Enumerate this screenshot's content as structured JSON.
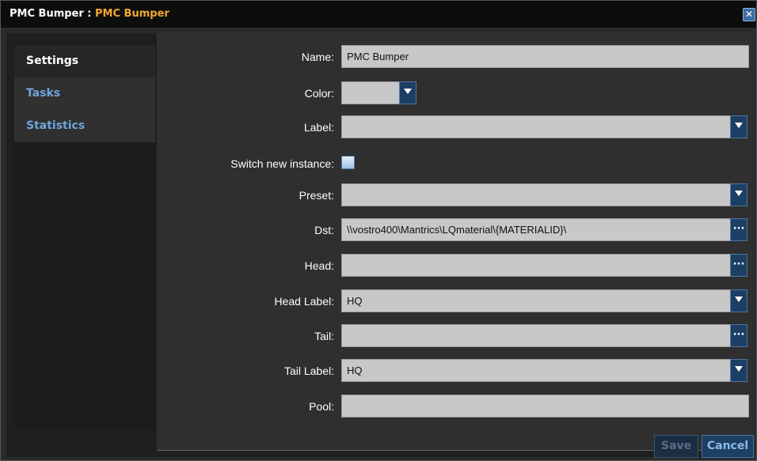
{
  "window": {
    "title_prefix": "PMC Bumper : ",
    "title_name": "PMC Bumper",
    "close_label": "✕"
  },
  "sidebar": {
    "items": [
      {
        "label": "Settings",
        "active": true
      },
      {
        "label": "Tasks",
        "active": false
      },
      {
        "label": "Statistics",
        "active": false
      }
    ]
  },
  "form": {
    "name": {
      "label": "Name:",
      "value": "PMC Bumper"
    },
    "color": {
      "label": "Color:",
      "value": ""
    },
    "label": {
      "label": "Label:",
      "value": ""
    },
    "switch_new_instance": {
      "label": "Switch new instance:",
      "checked": false
    },
    "preset": {
      "label": "Preset:",
      "value": ""
    },
    "dst": {
      "label": "Dst:",
      "value": "\\\\vostro400\\Mantrics\\LQmaterial\\{MATERIALID}\\"
    },
    "head": {
      "label": "Head:",
      "value": ""
    },
    "head_label": {
      "label": "Head Label:",
      "value": "HQ"
    },
    "tail": {
      "label": "Tail:",
      "value": ""
    },
    "tail_label": {
      "label": "Tail Label:",
      "value": "HQ"
    },
    "pool": {
      "label": "Pool:",
      "value": ""
    }
  },
  "buttons": {
    "browse": "···",
    "save": "Save",
    "cancel": "Cancel"
  },
  "colors": {
    "accent": "#f0a830",
    "link": "#6fa4dc",
    "button": "#1d3f63"
  }
}
